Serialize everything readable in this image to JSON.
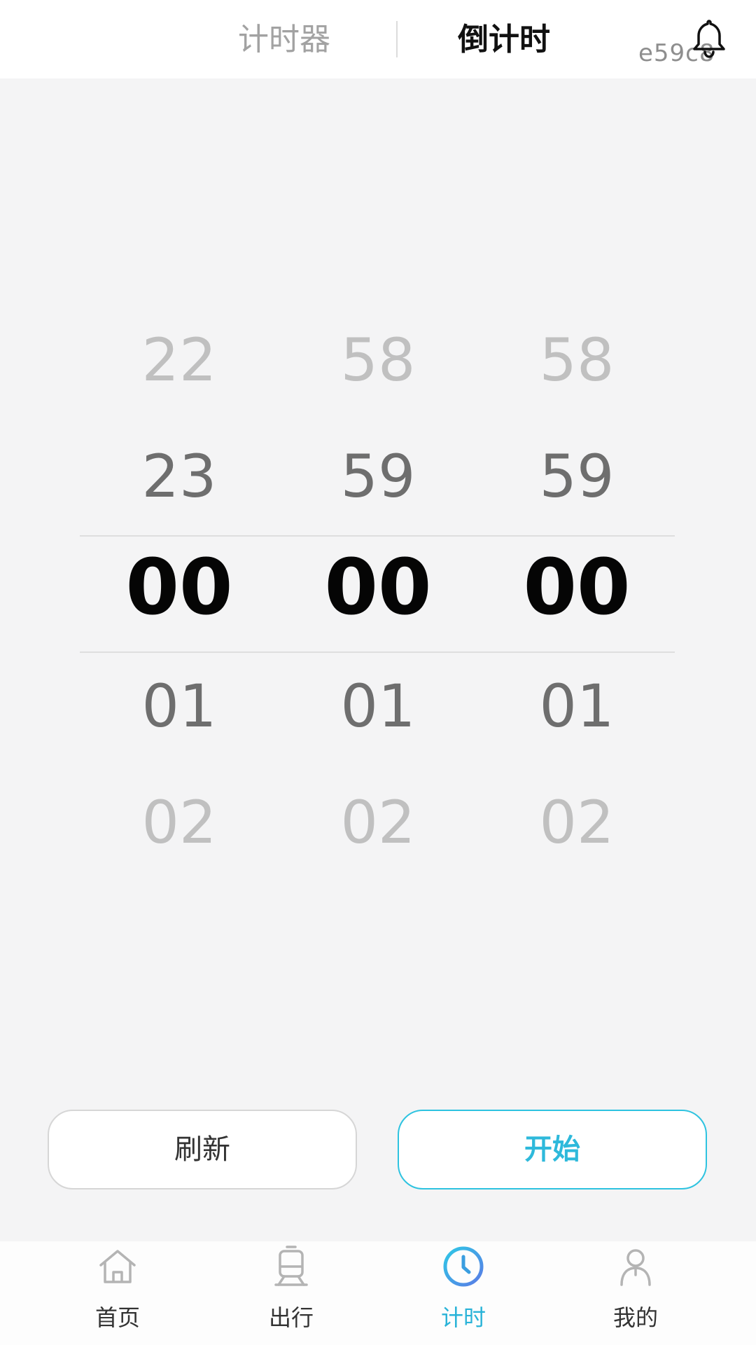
{
  "header": {
    "tabs": [
      {
        "label": "计时器",
        "active": false
      },
      {
        "label": "倒计时",
        "active": true
      }
    ],
    "device_id": "e59c8",
    "bell_icon": "bell-icon"
  },
  "picker": {
    "columns": [
      {
        "name": "hours",
        "items": [
          "22",
          "23",
          "00",
          "01",
          "02"
        ],
        "selected": "00"
      },
      {
        "name": "minutes",
        "items": [
          "58",
          "59",
          "00",
          "01",
          "02"
        ],
        "selected": "00"
      },
      {
        "name": "seconds",
        "items": [
          "58",
          "59",
          "00",
          "01",
          "02"
        ],
        "selected": "00"
      }
    ]
  },
  "buttons": {
    "refresh_label": "刷新",
    "start_label": "开始"
  },
  "nav": {
    "items": [
      {
        "label": "首页",
        "icon": "home-icon",
        "active": false
      },
      {
        "label": "出行",
        "icon": "train-icon",
        "active": false
      },
      {
        "label": "计时",
        "icon": "clock-icon",
        "active": true
      },
      {
        "label": "我的",
        "icon": "profile-icon",
        "active": false
      }
    ]
  },
  "colors": {
    "accent": "#2eb9db",
    "accent_border": "#2ec3e0",
    "background": "#f4f4f5",
    "inactive_text": "#a2a2a2"
  }
}
